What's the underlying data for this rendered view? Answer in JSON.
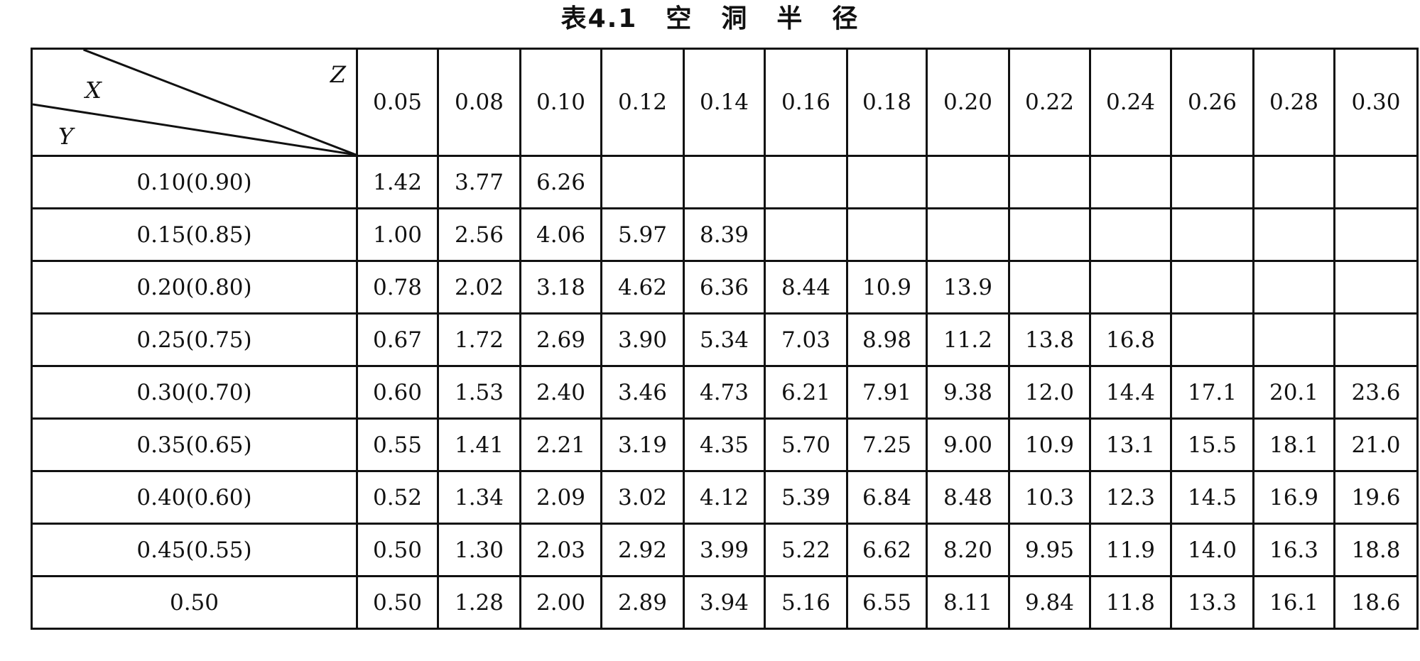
{
  "title": {
    "label": "表4.1",
    "words": [
      "空",
      "洞",
      "半",
      "径"
    ]
  },
  "corner": {
    "x_label": "X",
    "y_label": "Y",
    "z_label": "Z"
  },
  "columns": [
    "0.05",
    "0.08",
    "0.10",
    "0.12",
    "0.14",
    "0.16",
    "0.18",
    "0.20",
    "0.22",
    "0.24",
    "0.26",
    "0.28",
    "0.30"
  ],
  "rows": [
    {
      "label": "0.10(0.90)",
      "values": [
        "1.42",
        "3.77",
        "6.26",
        "",
        "",
        "",
        "",
        "",
        "",
        "",
        "",
        "",
        ""
      ]
    },
    {
      "label": "0.15(0.85)",
      "values": [
        "1.00",
        "2.56",
        "4.06",
        "5.97",
        "8.39",
        "",
        "",
        "",
        "",
        "",
        "",
        "",
        ""
      ]
    },
    {
      "label": "0.20(0.80)",
      "values": [
        "0.78",
        "2.02",
        "3.18",
        "4.62",
        "6.36",
        "8.44",
        "10.9",
        "13.9",
        "",
        "",
        "",
        "",
        ""
      ]
    },
    {
      "label": "0.25(0.75)",
      "values": [
        "0.67",
        "1.72",
        "2.69",
        "3.90",
        "5.34",
        "7.03",
        "8.98",
        "11.2",
        "13.8",
        "16.8",
        "",
        "",
        ""
      ]
    },
    {
      "label": "0.30(0.70)",
      "values": [
        "0.60",
        "1.53",
        "2.40",
        "3.46",
        "4.73",
        "6.21",
        "7.91",
        "9.38",
        "12.0",
        "14.4",
        "17.1",
        "20.1",
        "23.6"
      ]
    },
    {
      "label": "0.35(0.65)",
      "values": [
        "0.55",
        "1.41",
        "2.21",
        "3.19",
        "4.35",
        "5.70",
        "7.25",
        "9.00",
        "10.9",
        "13.1",
        "15.5",
        "18.1",
        "21.0"
      ]
    },
    {
      "label": "0.40(0.60)",
      "values": [
        "0.52",
        "1.34",
        "2.09",
        "3.02",
        "4.12",
        "5.39",
        "6.84",
        "8.48",
        "10.3",
        "12.3",
        "14.5",
        "16.9",
        "19.6"
      ]
    },
    {
      "label": "0.45(0.55)",
      "values": [
        "0.50",
        "1.30",
        "2.03",
        "2.92",
        "3.99",
        "5.22",
        "6.62",
        "8.20",
        "9.95",
        "11.9",
        "14.0",
        "16.3",
        "18.8"
      ]
    },
    {
      "label": "0.50",
      "values": [
        "0.50",
        "1.28",
        "2.00",
        "2.89",
        "3.94",
        "5.16",
        "6.55",
        "8.11",
        "9.84",
        "11.8",
        "13.3",
        "16.1",
        "18.6"
      ]
    }
  ]
}
